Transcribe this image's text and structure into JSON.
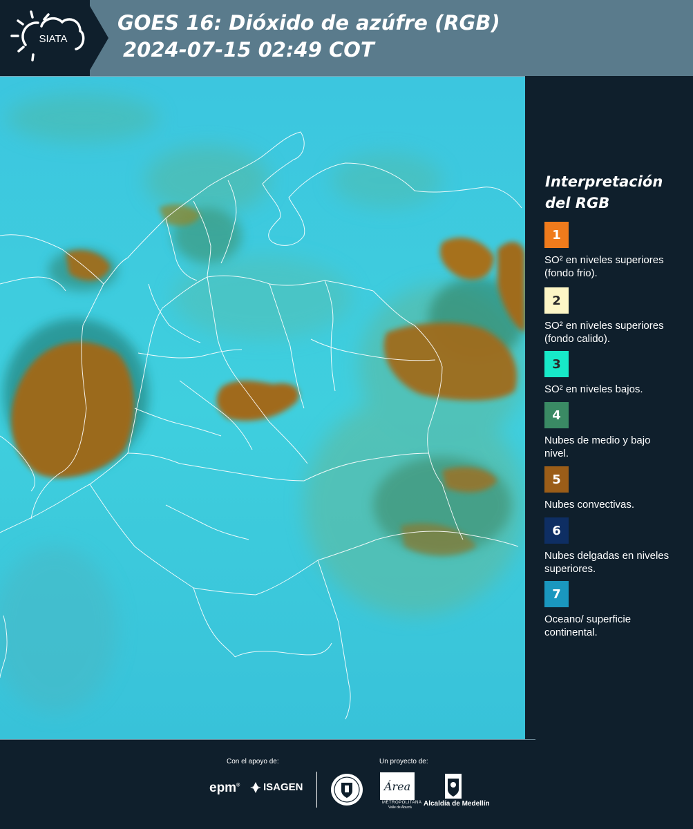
{
  "header": {
    "logo_text": "SIATA",
    "title_line1": "GOES 16: Dióxido de azúfre (RGB)",
    "title_line2": "2024-07-15 02:49 COT"
  },
  "legend": {
    "title_line1": "Interpretación",
    "title_line2": "del RGB",
    "items": [
      {
        "number": "1",
        "color": "#f07b1c",
        "text_color": "#ffffff",
        "label": "SO² en niveles superiores (fondo frio)."
      },
      {
        "number": "2",
        "color": "#fdf6c6",
        "text_color": "#2a2a2a",
        "label": "SO² en niveles superiores (fondo calido)."
      },
      {
        "number": "3",
        "color": "#17e9c8",
        "text_color": "#2a2a2a",
        "label": "SO² en niveles bajos."
      },
      {
        "number": "4",
        "color": "#3a8a64",
        "text_color": "#ffffff",
        "label": "Nubes de medio y bajo nivel."
      },
      {
        "number": "5",
        "color": "#9b5d18",
        "text_color": "#ffffff",
        "label": "Nubes convectivas."
      },
      {
        "number": "6",
        "color": "#0e2e63",
        "text_color": "#ffffff",
        "label": "Nubes delgadas en niveles superiores."
      },
      {
        "number": "7",
        "color": "#1a97bf",
        "text_color": "#ffffff",
        "label": "Oceano/ superficie continental."
      }
    ]
  },
  "footer": {
    "support_label": "Con el apoyo de:",
    "project_label": "Un proyecto de:",
    "epm": "epm",
    "isagen": "ISAGEN",
    "area_logo_text": "Área",
    "area_sub1": "METROPOLITANA",
    "area_sub2": "Valle de Aburrá",
    "alcaldia": "Alcaldía de Medellín"
  },
  "colors": {
    "background": "#0f1f2c",
    "header_band": "#5a7b8c",
    "map_base": "#3ec9dc",
    "convective": "#9b6a1a",
    "border_lines": "#ffffff"
  }
}
